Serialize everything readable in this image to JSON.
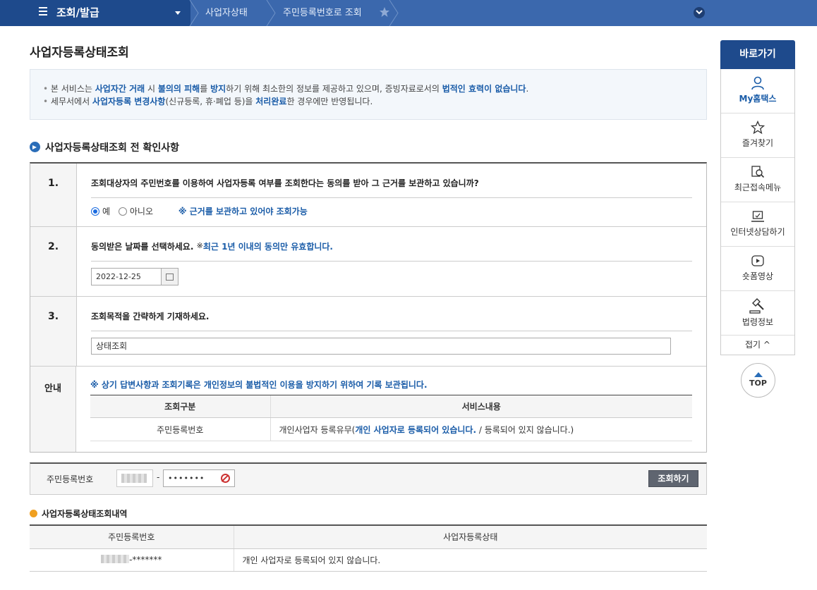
{
  "nav": {
    "menu_title": "조회/발급",
    "crumbs": [
      "사업자상태",
      "주민등록번호로 조회"
    ]
  },
  "page_title": "사업자등록상태조회",
  "info": {
    "line1": {
      "t1": "본 서비스는 ",
      "h1": "사업자간 거래",
      "t2": " 시 ",
      "h2": "불의의 피해",
      "t3": "를 ",
      "h3": "방지",
      "t4": "하기 위해 최소한의 정보를 제공하고 있으며, 증빙자료로서의 ",
      "h4": "법적인 효력이 없습니다",
      "t5": "."
    },
    "line2": {
      "t1": "세무서에서 ",
      "h1": "사업자등록 변경사항",
      "t2": "(신규등록, 휴·폐업 등)을 ",
      "h2": "처리완료",
      "t3": "한 경우에만 반영됩니다."
    }
  },
  "section_title": "사업자등록상태조회 전 확인사항",
  "q1": {
    "num": "1.",
    "text": "조회대상자의 주민번호를 이용하여 사업자등록 여부를 조회한다는 동의를 받아 그 근거를 보관하고 있습니까?",
    "yes": "예",
    "no": "아니오",
    "note": "※ 근거를 보관하고 있어야 조회가능"
  },
  "q2": {
    "num": "2.",
    "text": "동의받은 날짜를 선택하세요.",
    "note_mark": "※",
    "note": "최근 1년 이내의 동의만 유효합니다.",
    "date": "2022-12-25"
  },
  "q3": {
    "num": "3.",
    "text": "조회목적을 간략하게 기재하세요.",
    "value": "상태조회"
  },
  "guide": {
    "label": "안내",
    "note": "※ 상기 답변사항과 조회기록은 개인정보의 불법적인 이용을 방지하기 위하여 기록 보관됩니다.",
    "headers": [
      "조회구분",
      "서비스내용"
    ],
    "row_type": "주민등록번호",
    "row_pre": "개인사업자 등록유무(",
    "row_hl": "개인 사업자로 등록되어 있습니다.",
    "row_post": " / 등록되어 있지 않습니다.)"
  },
  "idbar": {
    "label": "주민등록번호",
    "dash": "-",
    "pw": "•••••••",
    "button": "조회하기"
  },
  "result": {
    "title": "사업자등록상태조회내역",
    "headers": [
      "주민등록번호",
      "사업자등록상태"
    ],
    "row_id": "-*******",
    "row_status": "개인 사업자로 등록되어 있지 않습니다."
  },
  "side": {
    "title": "바로가기",
    "items": [
      "My홈택스",
      "즐겨찾기",
      "최근접속메뉴",
      "인터넷상담하기",
      "숏폼영상",
      "법령정보"
    ],
    "fold": "접기 ^",
    "top": "TOP"
  },
  "colors": {
    "primary": "#1e4a8c",
    "nav": "#3b68ad",
    "highlight": "#1a5ca8"
  }
}
